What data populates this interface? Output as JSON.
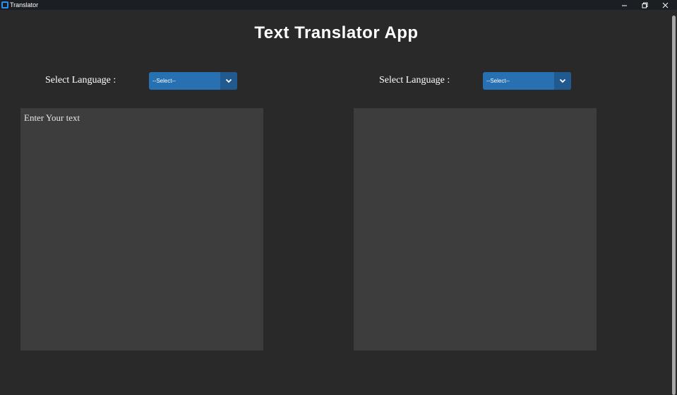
{
  "window": {
    "title": "Translator"
  },
  "header": {
    "title": "Text Translator App"
  },
  "source": {
    "label": "Select Language :",
    "selected": "--Select--",
    "placeholder": "Enter Your text"
  },
  "target": {
    "label": "Select Language :",
    "selected": "--Select--",
    "text": ""
  },
  "colors": {
    "background": "#292929",
    "titlebar": "#1b1e22",
    "accent": "#2770b2",
    "accent_dark": "#205a8f",
    "textbox": "#3d3d3d"
  },
  "icons": {
    "app": "app-icon",
    "minimize": "minimize-icon",
    "maximize": "restore-icon",
    "close": "close-icon",
    "dropdown": "chevron-down-icon"
  }
}
